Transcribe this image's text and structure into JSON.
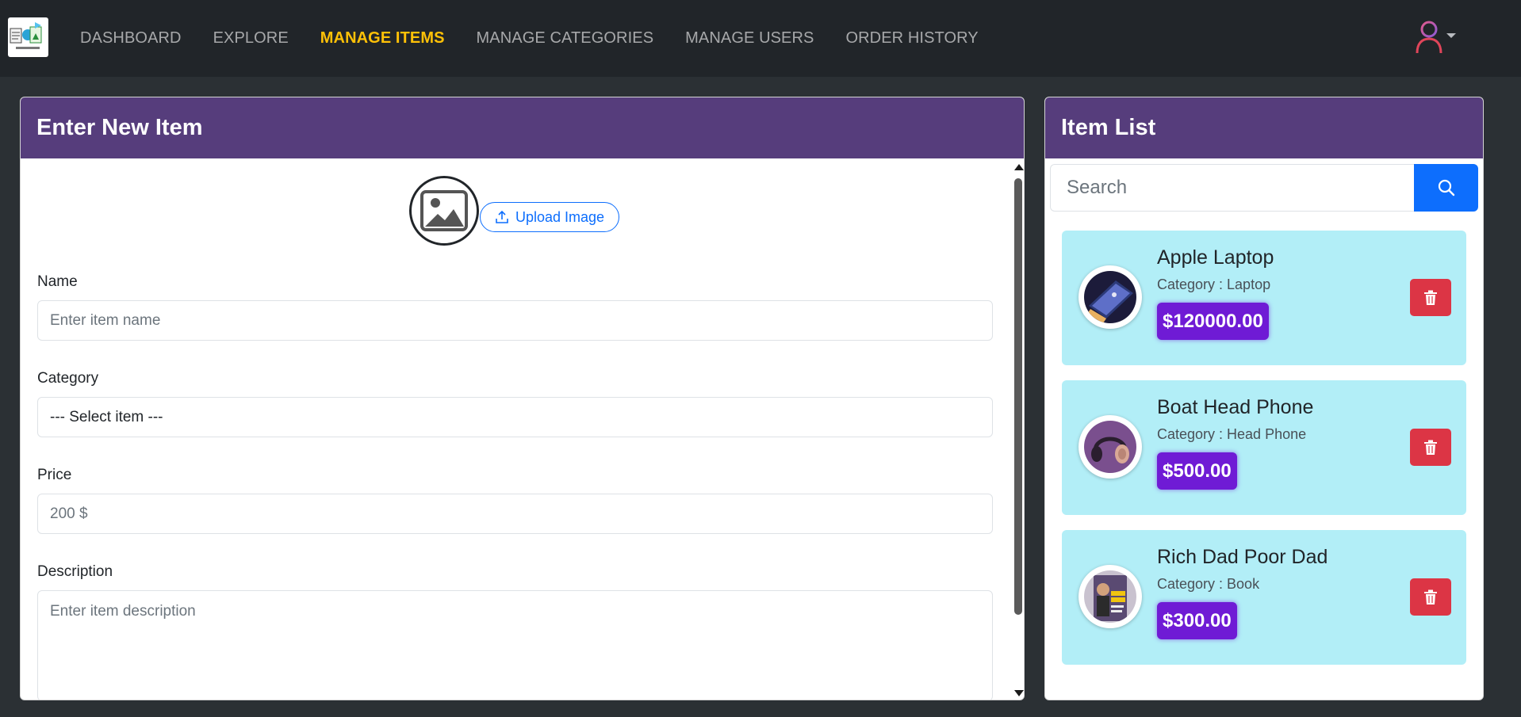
{
  "nav": {
    "links": [
      {
        "label": "DASHBOARD"
      },
      {
        "label": "EXPLORE"
      },
      {
        "label": "MANAGE ITEMS"
      },
      {
        "label": "MANAGE CATEGORIES"
      },
      {
        "label": "MANAGE USERS"
      },
      {
        "label": "ORDER HISTORY"
      }
    ],
    "active": "MANAGE ITEMS"
  },
  "form": {
    "title": "Enter New Item",
    "upload_label": "Upload Image",
    "name_label": "Name",
    "name_placeholder": "Enter item name",
    "category_label": "Category",
    "category_selected": "--- Select item ---",
    "price_label": "Price",
    "price_placeholder": "200 $",
    "description_label": "Description",
    "description_placeholder": "Enter item description"
  },
  "list": {
    "title": "Item List",
    "search_placeholder": "Search",
    "items": [
      {
        "name": "Apple Laptop",
        "category": "Category : Laptop",
        "price": "$120000.00",
        "thumb_icon": "laptop-thumb-icon"
      },
      {
        "name": "Boat Head Phone",
        "category": "Category : Head Phone",
        "price": "$500.00",
        "thumb_icon": "headphone-thumb-icon"
      },
      {
        "name": "Rich Dad Poor Dad",
        "category": "Category : Book",
        "price": "$300.00",
        "thumb_icon": "book-thumb-icon"
      }
    ]
  },
  "colors": {
    "navbar": "#212529",
    "active_link": "#ffc107",
    "card_header": "#563d7c",
    "item_bg": "#b2eef7",
    "price_badge": "#6f1bd5",
    "delete": "#dc3545",
    "search_button": "#0d6efd"
  }
}
